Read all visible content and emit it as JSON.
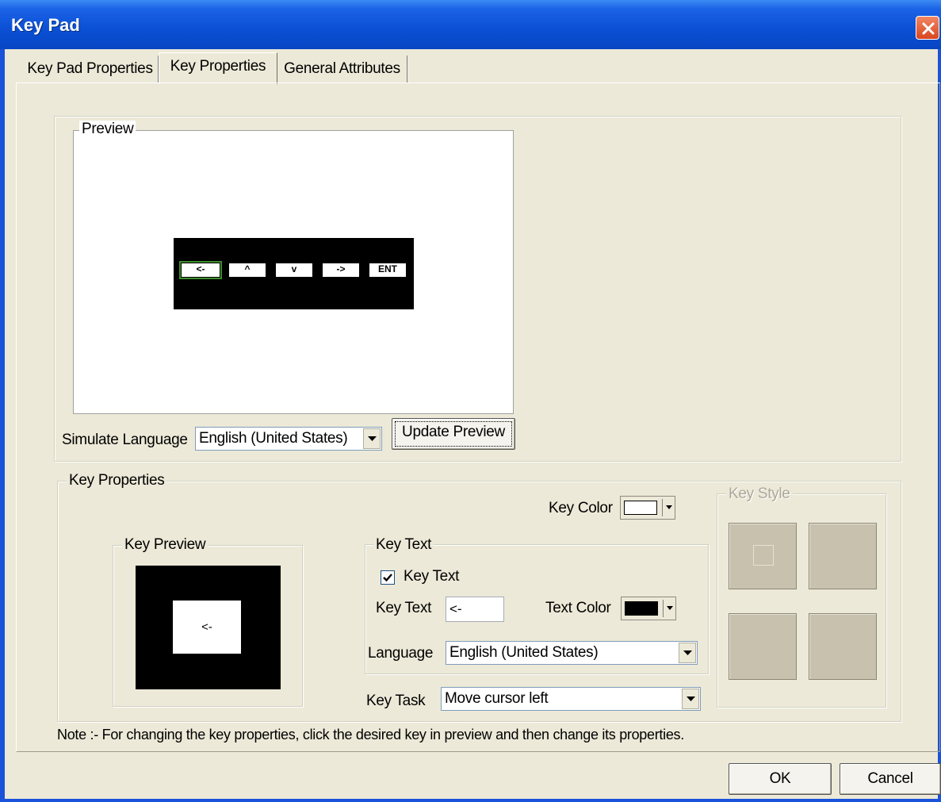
{
  "window": {
    "title": "Key Pad"
  },
  "tabs": [
    {
      "label": "Key Pad Properties"
    },
    {
      "label": "Key  Properties"
    },
    {
      "label": "General Attributes"
    }
  ],
  "preview": {
    "legend": "Preview",
    "keys": [
      "<-",
      "^",
      "v",
      "->",
      "ENT"
    ],
    "simulate_language_label": "Simulate Language",
    "simulate_language_value": "English (United States)",
    "update_button": "Update Preview"
  },
  "key_properties": {
    "legend": "Key Properties",
    "key_color_label": "Key Color",
    "key_color": "#ffffff",
    "key_preview": {
      "legend": "Key Preview",
      "text": "<-"
    },
    "key_text_group": {
      "legend": "Key Text",
      "checkbox_label": "Key Text",
      "checked": true,
      "key_text_label": "Key Text",
      "key_text_value": "<-",
      "text_color_label": "Text Color",
      "text_color": "#000000",
      "language_label": "Language",
      "language_value": "English (United States)"
    },
    "key_task_label": "Key Task",
    "key_task_value": "Move cursor left",
    "key_style_legend": "Key Style"
  },
  "note": "Note :- For changing the key properties, click the desired key in preview and then change its properties.",
  "buttons": {
    "ok": "OK",
    "cancel": "Cancel"
  }
}
